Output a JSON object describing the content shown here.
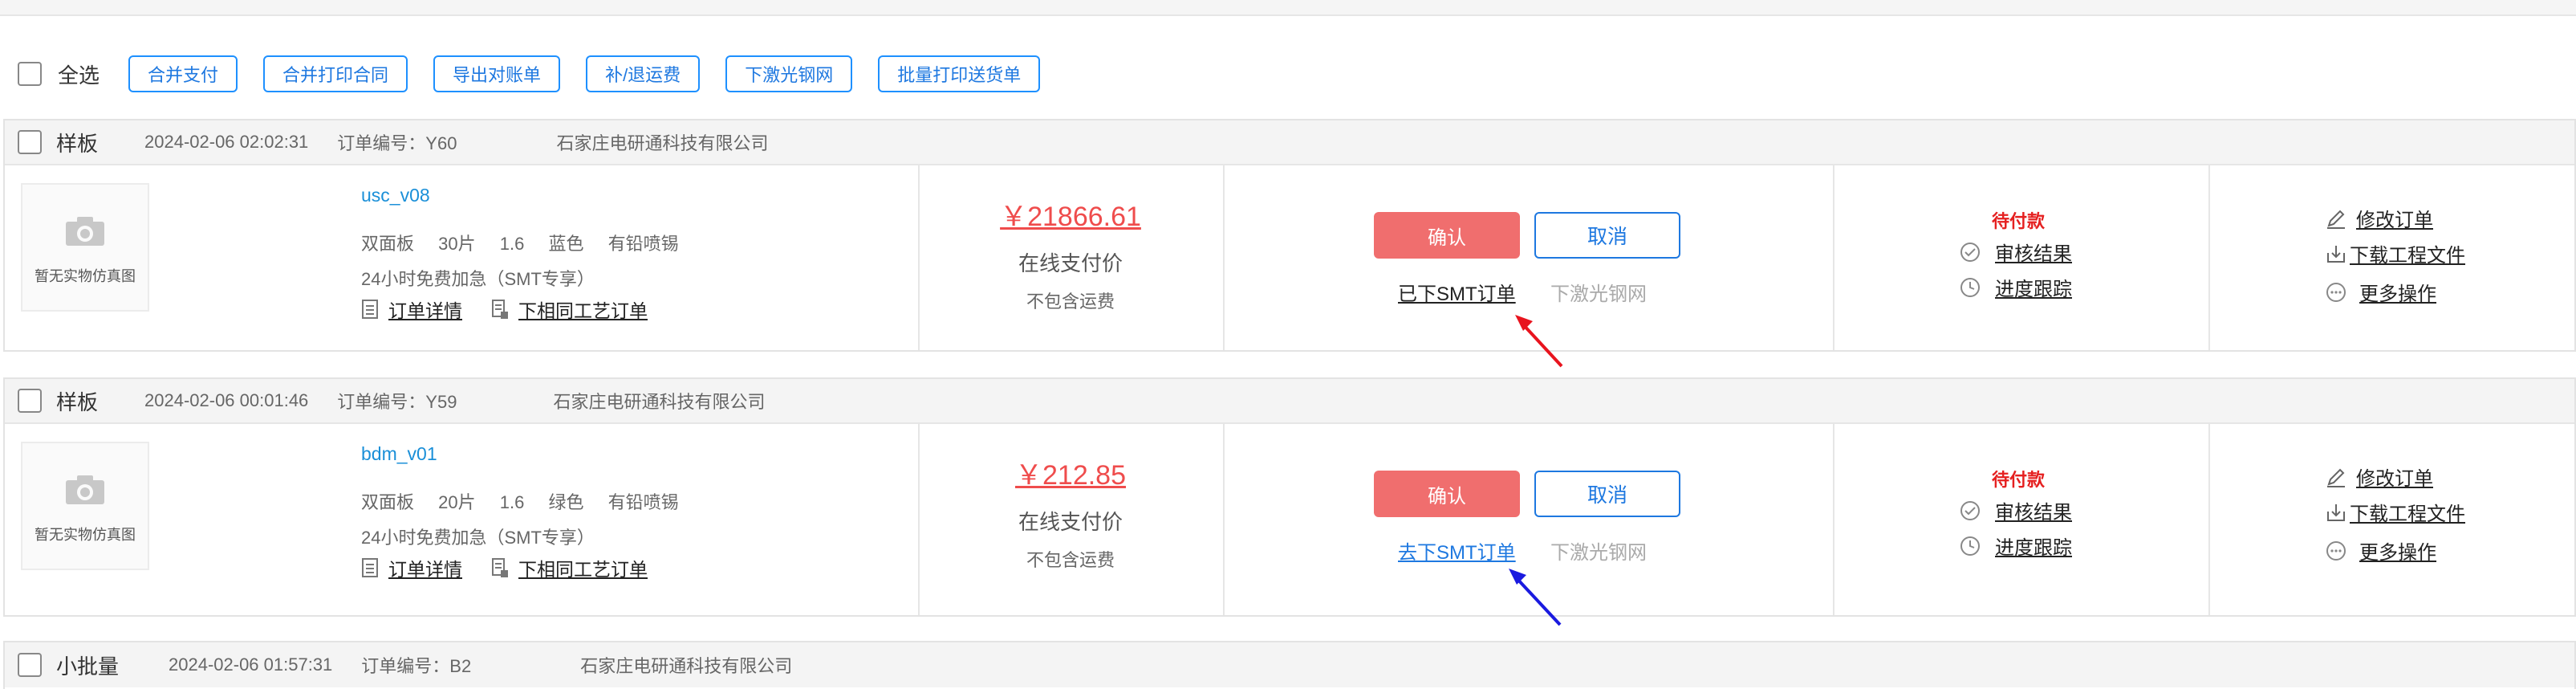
{
  "toolbar": {
    "select_all": "全选",
    "buttons": [
      "合并支付",
      "合并打印合同",
      "导出对账单",
      "补/退运费",
      "下激光钢网",
      "批量打印送货单"
    ]
  },
  "orders": [
    {
      "type": "样板",
      "datetime": "2024-02-06 02:02:31",
      "order_no": "订单编号：Y60",
      "company": "石家庄电研通科技有限公司",
      "thumb_text": "暂无实物仿真图",
      "product_name": "usc_v08",
      "spec": [
        "双面板",
        "30片",
        "1.6",
        "蓝色",
        "有铅喷锡"
      ],
      "rush": "24小时免费加急（SMT专享）",
      "detail_link": "订单详情",
      "same_process_link": "下相同工艺订单",
      "price": "￥21866.61",
      "pay_label": "在线支付价",
      "freight_note": "不包含运费",
      "confirm": "确认",
      "cancel": "取消",
      "smt_link": "已下SMT订单",
      "laser_link": "下激光钢网",
      "status": "待付款",
      "review": "审核结果",
      "progress": "进度跟踪",
      "ops": [
        "修改订单",
        "下载工程文件",
        "更多操作"
      ]
    },
    {
      "type": "样板",
      "datetime": "2024-02-06 00:01:46",
      "order_no": "订单编号：Y59",
      "company": "石家庄电研通科技有限公司",
      "thumb_text": "暂无实物仿真图",
      "product_name": "bdm_v01",
      "spec": [
        "双面板",
        "20片",
        "1.6",
        "绿色",
        "有铅喷锡"
      ],
      "rush": "24小时免费加急（SMT专享）",
      "detail_link": "订单详情",
      "same_process_link": "下相同工艺订单",
      "price": "￥212.85",
      "pay_label": "在线支付价",
      "freight_note": "不包含运费",
      "confirm": "确认",
      "cancel": "取消",
      "smt_link": "去下SMT订单",
      "laser_link": "下激光钢网",
      "status": "待付款",
      "review": "审核结果",
      "progress": "进度跟踪",
      "ops": [
        "修改订单",
        "下载工程文件",
        "更多操作"
      ]
    },
    {
      "type": "小批量",
      "datetime": "2024-02-06 01:57:31",
      "order_no": "订单编号：B2",
      "company": "石家庄电研通科技有限公司"
    }
  ],
  "annotations": [
    {
      "color": "#e8141e",
      "target": "已下SMT订单"
    },
    {
      "color": "#1a1adf",
      "target": "去下SMT订单"
    }
  ],
  "colors": {
    "accent_blue": "#1e78e0",
    "price_red": "#ef4c4c",
    "confirm_bg": "#f06e6e",
    "status_red": "#e52020",
    "link_blue": "#1a8fd8"
  }
}
